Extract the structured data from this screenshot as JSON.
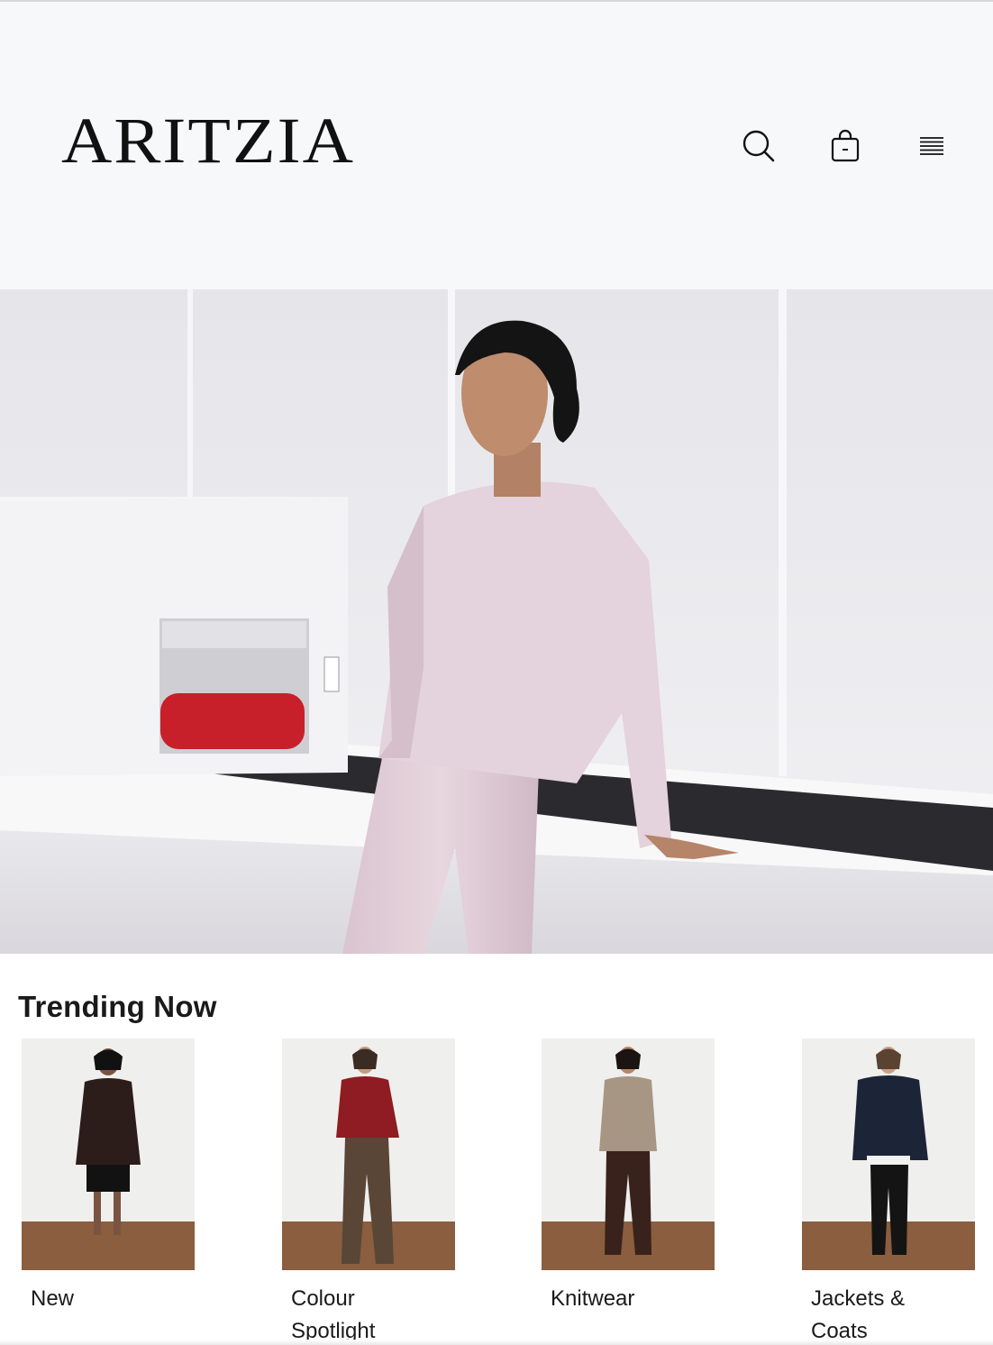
{
  "header": {
    "logo_text": "ARITZIA",
    "icons": [
      "search-icon",
      "shopping-bag-icon",
      "menu-icon"
    ]
  },
  "hero": {
    "image_description": "model-in-pink-sweatsuit"
  },
  "trending": {
    "title": "Trending Now",
    "items": [
      {
        "label": "New"
      },
      {
        "label": "Colour Spotlight"
      },
      {
        "label": "Knitwear"
      },
      {
        "label": "Jackets & Coats"
      }
    ]
  },
  "colors": {
    "header_bg": "#f7f8fa",
    "text": "#111111",
    "hero_outfit": "#e2d0d8",
    "conveyor_red": "#c8202a"
  }
}
